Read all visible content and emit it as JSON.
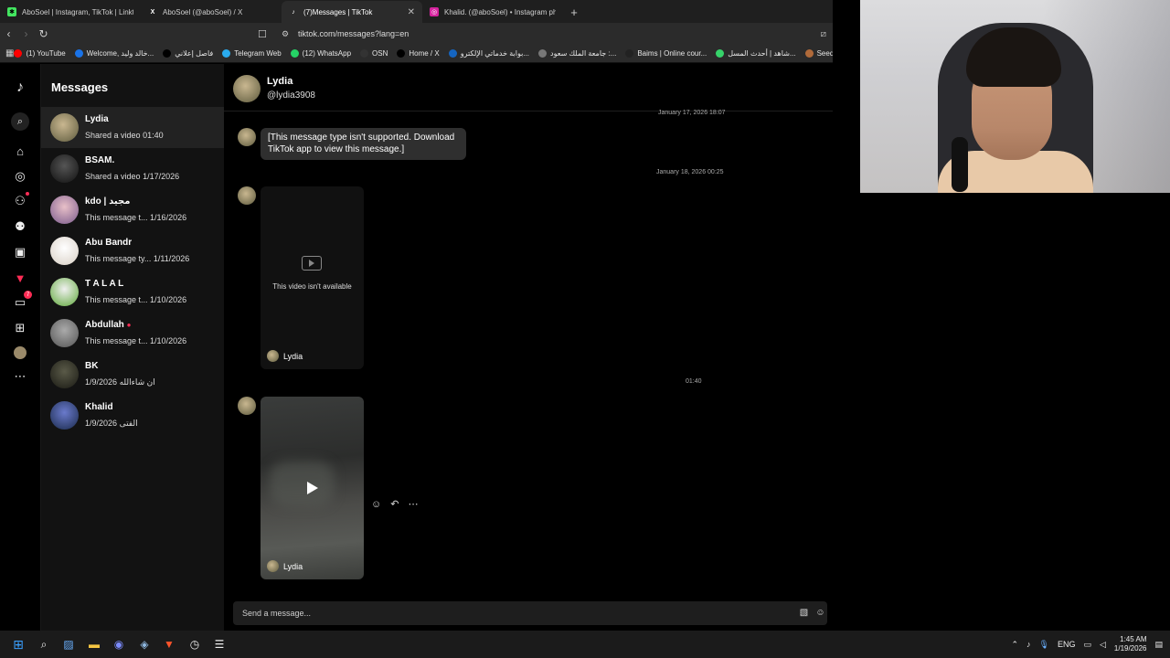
{
  "browser": {
    "tabs": [
      {
        "label": "AboSoel | Instagram, TikTok | Linktree",
        "fav_color": "#43e660",
        "fav_glyph": "✱"
      },
      {
        "label": "AboSoel (@aboSoel) / X",
        "fav_color": "#1f1f1f",
        "fav_glyph": "X"
      },
      {
        "label": "(7)Messages | TikTok",
        "fav_color": "#1f1f1f",
        "fav_glyph": "♪"
      },
      {
        "label": "Khalid. (@aboSoel) • Instagram phot",
        "fav_color": "#d6249f",
        "fav_glyph": "◎"
      }
    ],
    "new_tab": "+",
    "url": "tiktok.com/messages?lang=en",
    "bookmarks": [
      {
        "label": "(1) YouTube",
        "color": "#ff0000"
      },
      {
        "label": "Welcome, خالد وليد...",
        "color": "#1a73e8"
      },
      {
        "label": "فاصل إعلاني",
        "color": "#000000"
      },
      {
        "label": "Telegram Web",
        "color": "#2aabee"
      },
      {
        "label": "(12) WhatsApp",
        "color": "#25d366"
      },
      {
        "label": "OSN",
        "color": "#333333"
      },
      {
        "label": "Home / X",
        "color": "#000000"
      },
      {
        "label": "بوابة خدماتي الإلكترو...",
        "color": "#1565c0"
      },
      {
        "label": "جامعة الملك سعود :...",
        "color": "#777777"
      },
      {
        "label": "Baims | Online cour...",
        "color": "#222222"
      },
      {
        "label": "شاهد | أحدث المسل...",
        "color": "#36d36a"
      },
      {
        "label": "Seed",
        "color": "#b06a3a"
      }
    ]
  },
  "sidebar": {
    "title": "Messages",
    "rail_badge": "7",
    "conversations": [
      {
        "name": "Lydia",
        "preview": "Shared a video",
        "time": "01:40",
        "avatar": "#8a8460"
      },
      {
        "name": "BSAM.",
        "preview": "Shared a video",
        "time": "1/17/2026",
        "avatar": "#2a2a2a"
      },
      {
        "name": "kdo | مجيد",
        "preview": "This message t...",
        "time": "1/16/2026",
        "avatar": "#b07a8c"
      },
      {
        "name": "Abu Bandr",
        "preview": "This message ty...",
        "time": "1/11/2026",
        "avatar": "#e8e0d8"
      },
      {
        "name": "T A L A L",
        "preview": "This message t...",
        "time": "1/10/2026",
        "avatar": "#7cc24a"
      },
      {
        "name": "Abdullah",
        "preview": "This message t...",
        "time": "1/10/2026",
        "avatar": "#8a8a8a"
      },
      {
        "name": "BK",
        "preview": "ان شاءالله",
        "time": "1/9/2026",
        "avatar": "#3a3a30"
      },
      {
        "name": "Khalid",
        "preview": "الفتى",
        "time": "1/9/2026",
        "avatar": "#3a4a7a"
      }
    ]
  },
  "chat": {
    "name": "Lydia",
    "handle": "@lydia3908",
    "timestamps": [
      "January 17, 2026 18:07",
      "January 18, 2026 00:25",
      "01:40"
    ],
    "unsupported": "[This message type isn't supported. Download TikTok app to view this message.]",
    "unavailable": "This video isn't available",
    "sender": "Lydia",
    "composer_placeholder": "Send a message..."
  },
  "taskbar": {
    "lang": "ENG",
    "time": "1:45 AM",
    "date": "1/19/2026"
  },
  "colors": {
    "accent": "#fe2c55",
    "panel": "#121212",
    "selected": "#222222"
  }
}
